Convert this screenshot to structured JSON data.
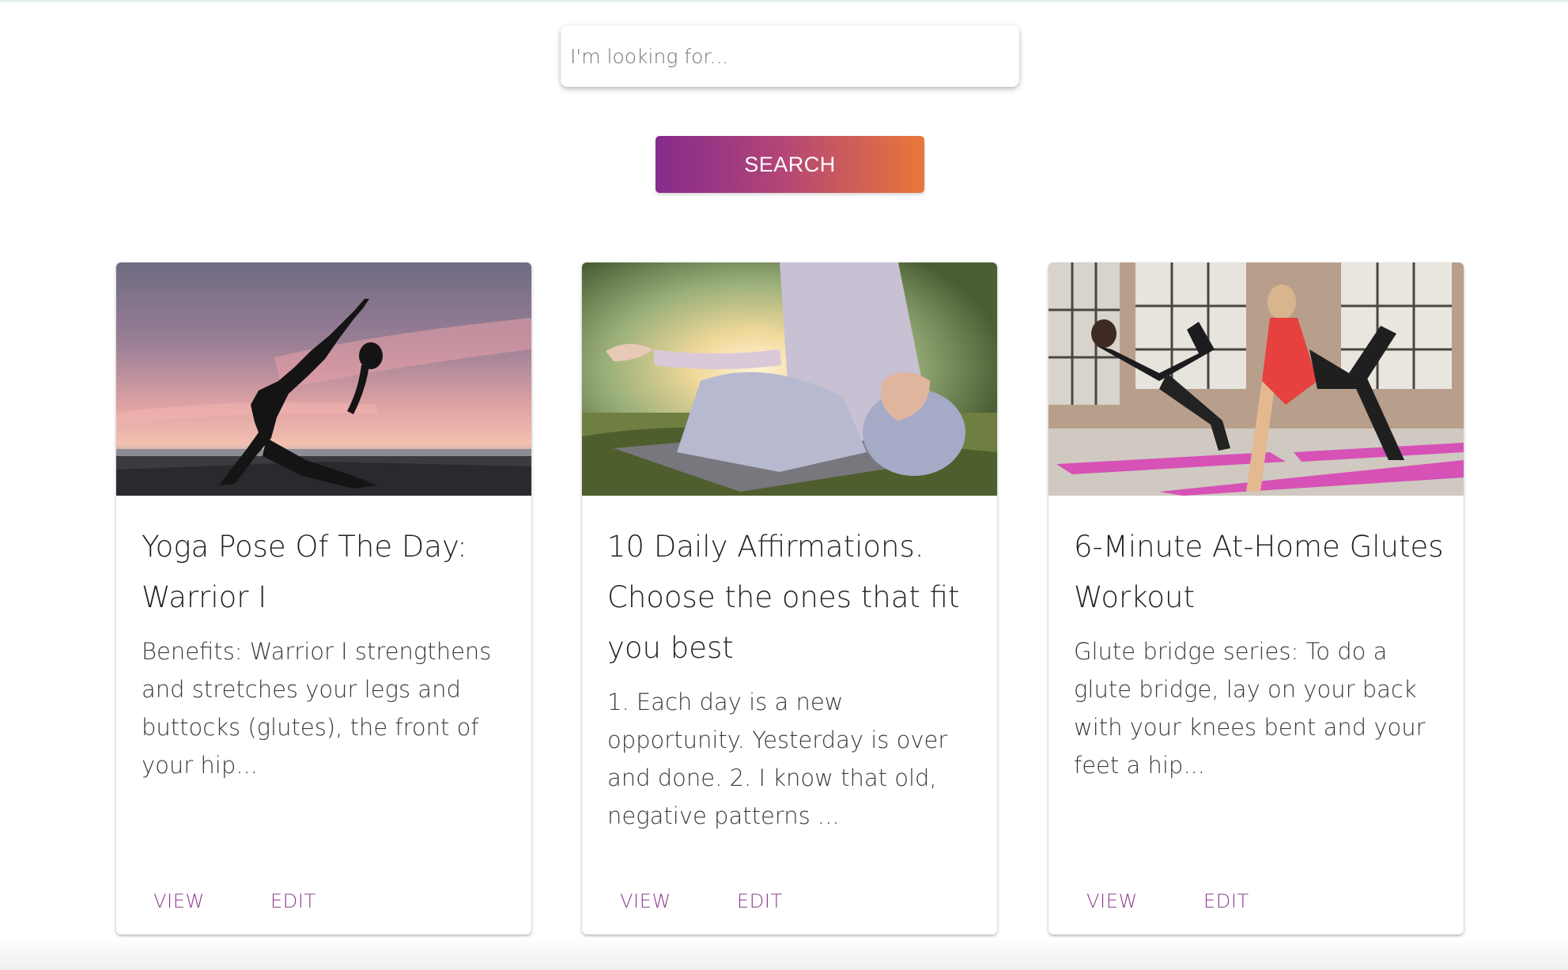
{
  "search": {
    "placeholder": "I'm looking for...",
    "button_label": "SEARCH",
    "button_gradient": [
      "#852b8c",
      "#e9773a"
    ]
  },
  "cards": [
    {
      "image": "yoga-silhouette-sunset",
      "title": "Yoga Pose Of The Day: Warrior I",
      "text": "Benefits: Warrior I strengthens and stretches your legs and buttocks (glutes), the front of your hip...",
      "view_label": "VIEW",
      "edit_label": "EDIT"
    },
    {
      "image": "meditation-lotus-pose",
      "title": "10 Daily Affirmations. Choose the ones that fit you best",
      "text": "1. Each day is a new opportunity. Yesterday is over and done. 2. I know that old, negative patterns ...",
      "view_label": "VIEW",
      "edit_label": "EDIT"
    },
    {
      "image": "glutes-workout-mats",
      "title": "6-Minute At-Home Glutes Workout",
      "text": "Glute bridge series: To do a glute bridge, lay on your back with your knees bent and your feet a hip...",
      "view_label": "VIEW",
      "edit_label": "EDIT"
    }
  ],
  "colors": {
    "action_text": "#8e3e92",
    "mat_pink": "#d652b6"
  }
}
